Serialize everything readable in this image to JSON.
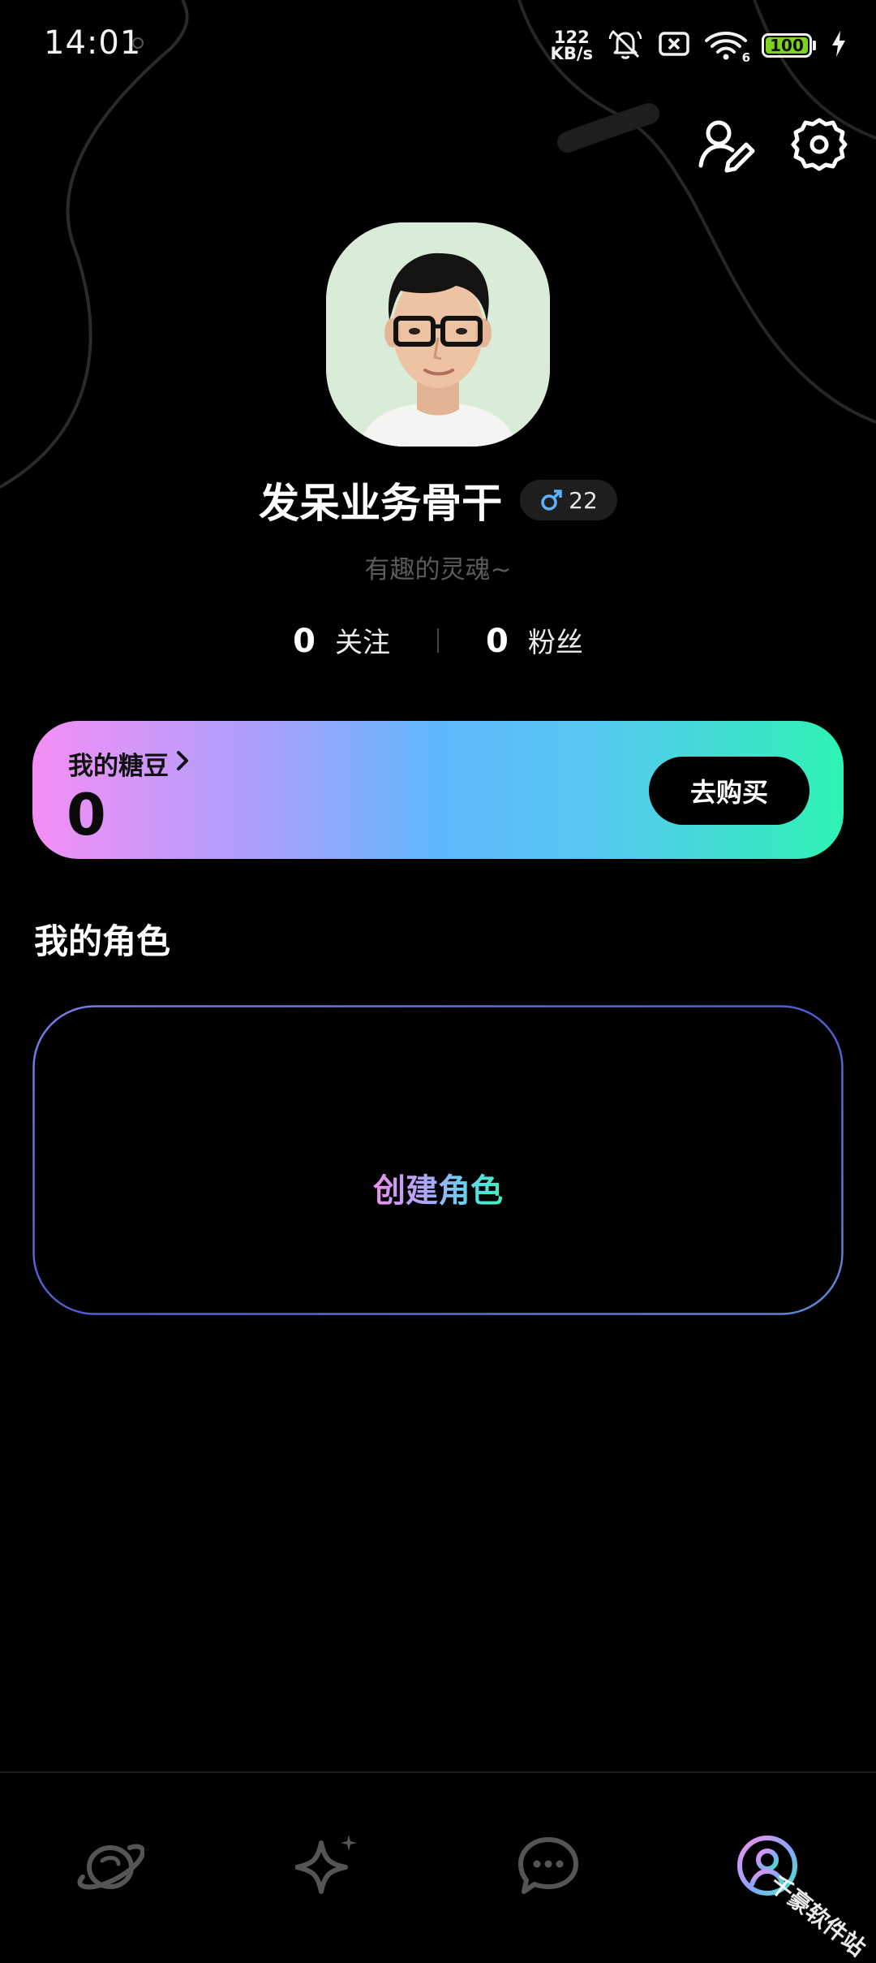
{
  "status_bar": {
    "time": "14:01",
    "net_speed_value": "122",
    "net_speed_unit": "KB/s",
    "wifi_label": "6",
    "battery_level": "100",
    "battery_fraction": 1.0
  },
  "profile": {
    "name": "发呆业务骨干",
    "gender_symbol": "♂",
    "age": "22",
    "bio": "有趣的灵魂~",
    "following_count": "0",
    "following_label": "关注",
    "followers_count": "0",
    "followers_label": "粉丝"
  },
  "candy": {
    "title": "我的糖豆",
    "chevron": "›",
    "value": "0",
    "buy_label": "去购买"
  },
  "roles": {
    "section_title": "我的角色",
    "create_label": "创建角色"
  },
  "bottom_nav": {
    "items": [
      {
        "icon": "planet-icon",
        "active": false
      },
      {
        "icon": "sparkle-icon",
        "active": false
      },
      {
        "icon": "chat-bubble-icon",
        "active": false
      },
      {
        "icon": "profile-icon",
        "active": true
      }
    ]
  },
  "watermark": "千豪软件站",
  "colors": {
    "background": "#000000",
    "candy_gradient_start": "#f58ef6",
    "candy_gradient_mid": "#5fb7fb",
    "candy_gradient_end": "#2ef3b4",
    "gender_blue": "#5ab4ff",
    "battery_green": "#7ed321"
  }
}
